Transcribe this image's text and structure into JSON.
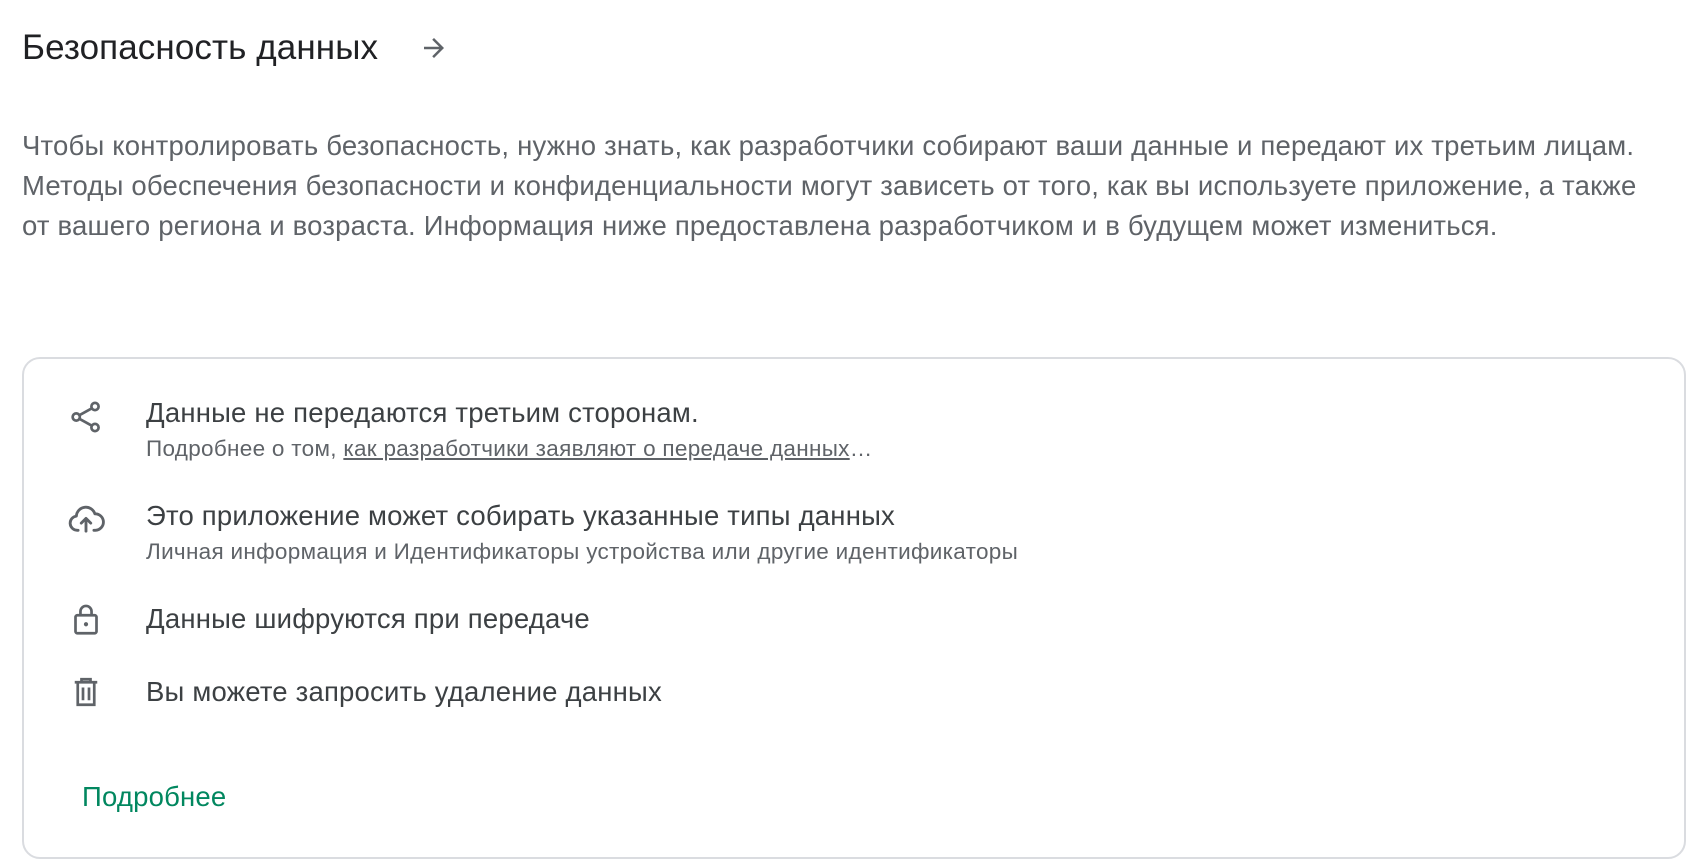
{
  "header": {
    "title": "Безопасность данных",
    "arrow_icon": "arrow-right-icon"
  },
  "intro": {
    "text": "Чтобы контролировать безопасность, нужно знать, как разработчики собирают ваши данные и передают их третьим лицам. Методы обеспечения безопасности и конфиденциальности могут зависеть от того, как вы используете приложение, а также от вашего региона и возраста. Информация ниже предоставлена разработчиком и в будущем может измениться."
  },
  "card": {
    "items": [
      {
        "icon": "share-icon",
        "title": "Данные не передаются третьим сторонам.",
        "sub_prefix": "Подробнее о том, ",
        "sub_link": "как разработчики заявляют о передаче данных",
        "sub_suffix": "…"
      },
      {
        "icon": "cloud-upload-icon",
        "title": "Это приложение может собирать указанные типы данных",
        "sub": "Личная информация и Идентификаторы устройства или другие идентификаторы"
      },
      {
        "icon": "lock-icon",
        "title": "Данные шифруются при передаче"
      },
      {
        "icon": "trash-icon",
        "title": "Вы можете запросить удаление данных"
      }
    ],
    "more_label": "Подробнее"
  },
  "colors": {
    "title": "#202124",
    "body": "#5f6368",
    "link_accent": "#01875f",
    "border": "#dadce0"
  }
}
